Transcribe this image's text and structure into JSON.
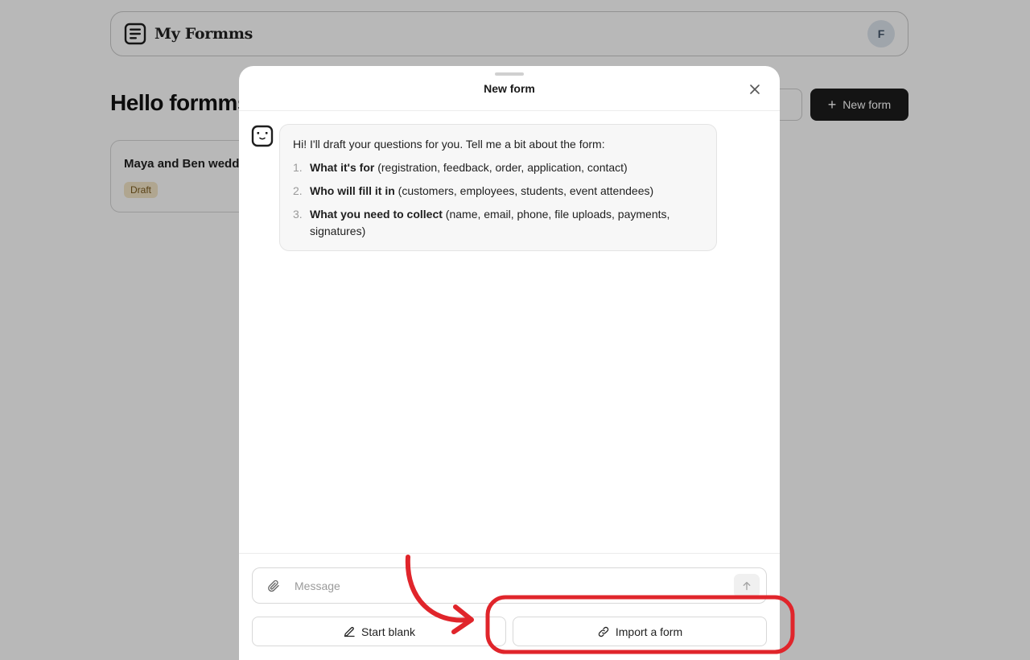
{
  "app": {
    "brand": "My Formms",
    "logo_icon": "form-document-icon",
    "avatar_initial": "F"
  },
  "dashboard": {
    "greeting": "Hello formms",
    "new_form_button": "New form",
    "forms": [
      {
        "title": "Maya and Ben wedd",
        "status": "Draft"
      }
    ]
  },
  "modal": {
    "title": "New form",
    "close_icon": "close-icon",
    "assistant_message": {
      "avatar_icon": "robot-icon",
      "intro": "Hi! I'll draft your questions for you. Tell me a bit about the form:",
      "items": [
        {
          "number": "1.",
          "label": "What it's for",
          "detail": " (registration, feedback, order, application, contact)"
        },
        {
          "number": "2.",
          "label": "Who will fill it in",
          "detail": " (customers, employees, students, event attendees)"
        },
        {
          "number": "3.",
          "label": "What you need to collect",
          "detail": " (name, email, phone, file uploads, payments, signatures)"
        }
      ]
    },
    "composer": {
      "placeholder": "Message",
      "value": "",
      "attach_icon": "paperclip-icon",
      "send_icon": "arrow-up-icon"
    },
    "actions": {
      "start_blank": "Start blank",
      "start_blank_icon": "pencil-icon",
      "import_form": "Import a form",
      "import_form_icon": "link-icon"
    }
  },
  "annotation": {
    "color": "#e0252b",
    "type": "arrow-and-circle"
  }
}
